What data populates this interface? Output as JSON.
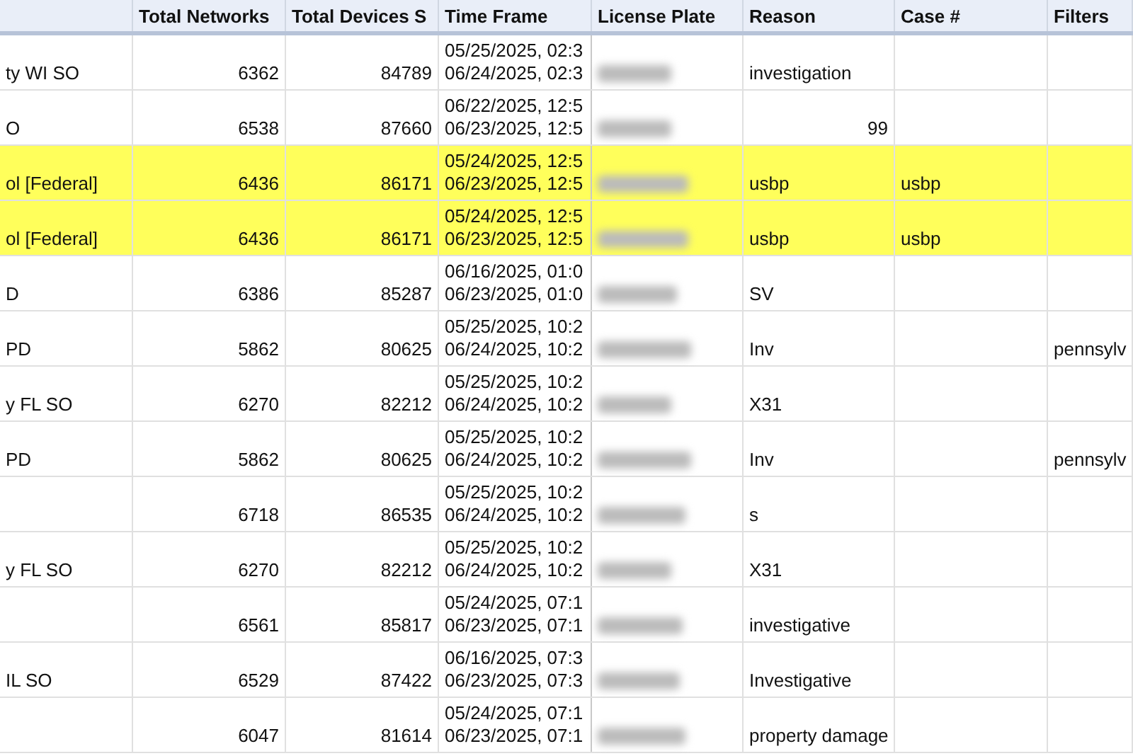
{
  "columns": [
    "Total Networks",
    "Total Devices S",
    "Time Frame",
    "License Plate",
    "Reason",
    "Case #",
    "Filters"
  ],
  "rows": [
    {
      "agency": "ty WI SO",
      "networks": "6362",
      "devices": "84789",
      "time_from": "05/25/2025, 02:3",
      "time_to": "06/24/2025, 02:3",
      "reason": {
        "kind": "text",
        "text": "investigation"
      },
      "highlighted": false
    },
    {
      "agency": "O",
      "networks": "6538",
      "devices": "87660",
      "time_from": "06/22/2025, 12:5",
      "time_to": "06/23/2025, 12:5",
      "reason": {
        "kind": "number",
        "text": "99"
      },
      "highlighted": false
    },
    {
      "agency": "ol [Federal]",
      "networks": "6436",
      "devices": "86171",
      "time_from": "05/24/2025, 12:5",
      "time_to": "06/23/2025, 12:5",
      "reason": {
        "kind": "text",
        "text": "usbp"
      },
      "case": "usbp",
      "highlighted": true
    },
    {
      "agency": "ol [Federal]",
      "networks": "6436",
      "devices": "86171",
      "time_from": "05/24/2025, 12:5",
      "time_to": "06/23/2025, 12:5",
      "reason": {
        "kind": "text",
        "text": "usbp"
      },
      "case": "usbp",
      "highlighted": true
    },
    {
      "agency": "D",
      "networks": "6386",
      "devices": "85287",
      "time_from": "06/16/2025, 01:0",
      "time_to": "06/23/2025, 01:0",
      "reason": {
        "kind": "text",
        "text": "SV"
      },
      "highlighted": false
    },
    {
      "agency": "PD",
      "networks": "5862",
      "devices": "80625",
      "time_from": "05/25/2025, 10:2",
      "time_to": "06/24/2025, 10:2",
      "reason": {
        "kind": "text",
        "text": "Inv"
      },
      "filters": "pennsylv",
      "highlighted": false
    },
    {
      "agency": "y FL SO",
      "networks": "6270",
      "devices": "82212",
      "time_from": "05/25/2025, 10:2",
      "time_to": "06/24/2025, 10:2",
      "reason": {
        "kind": "text",
        "text": "X31"
      },
      "highlighted": false
    },
    {
      "agency": "PD",
      "networks": "5862",
      "devices": "80625",
      "time_from": "05/25/2025, 10:2",
      "time_to": "06/24/2025, 10:2",
      "reason": {
        "kind": "text",
        "text": "Inv"
      },
      "filters": "pennsylv",
      "highlighted": false
    },
    {
      "networks": "6718",
      "devices": "86535",
      "time_from": "05/25/2025, 10:2",
      "time_to": "06/24/2025, 10:2",
      "reason": {
        "kind": "text",
        "text": "s"
      },
      "highlighted": false
    },
    {
      "agency": "y FL SO",
      "networks": "6270",
      "devices": "82212",
      "time_from": "05/25/2025, 10:2",
      "time_to": "06/24/2025, 10:2",
      "reason": {
        "kind": "text",
        "text": "X31"
      },
      "highlighted": false
    },
    {
      "networks": "6561",
      "devices": "85817",
      "time_from": "05/24/2025, 07:1",
      "time_to": "06/23/2025, 07:1",
      "reason": {
        "kind": "text",
        "text": "investigative"
      },
      "highlighted": false
    },
    {
      "agency": "IL SO",
      "networks": "6529",
      "devices": "87422",
      "time_from": "06/16/2025, 07:3",
      "time_to": "06/23/2025, 07:3",
      "reason": {
        "kind": "text",
        "text": "Investigative"
      },
      "highlighted": false
    },
    {
      "networks": "6047",
      "devices": "81614",
      "time_from": "05/24/2025, 07:1",
      "time_to": "06/23/2025, 07:1",
      "reason": {
        "kind": "text",
        "text": "property damage"
      },
      "highlighted": false
    }
  ]
}
